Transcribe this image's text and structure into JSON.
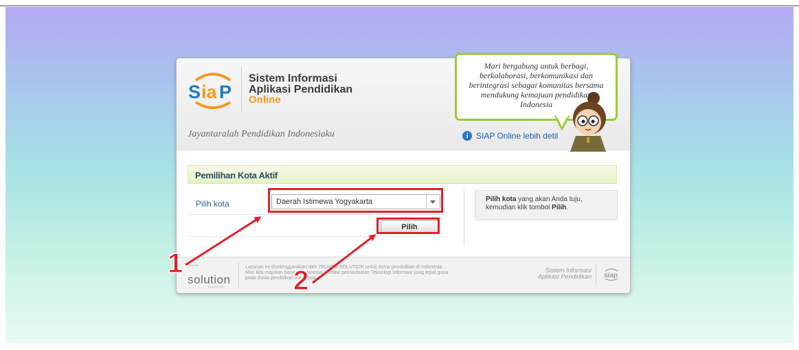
{
  "brand": {
    "logo_text": "SiaP",
    "title_line1": "Sistem Informasi",
    "title_line2": "Aplikasi Pendidikan",
    "title_line3": "Online",
    "tagline": "Jayantaralah Pendidikan Indonesiaku",
    "accent_color": "#f39a1e",
    "primary_color": "#1d7bc4"
  },
  "speech": {
    "text": "Mari bergabung untuk berbagi, berkolaborasi, berkomunikasi dan berintegrasi sebagai komunitas bersama mendukung kemajuan pendidikan Indonesia"
  },
  "detail_link": {
    "label": "SIAP Online lebih detil"
  },
  "form": {
    "section_title": "Pemilihan Kota Aktif",
    "city_label": "Pilih kota",
    "city_selected": "Daerah Istimewa Yogyakarta",
    "submit_label": "Pilih"
  },
  "help": {
    "bold_1": "Pilih kota",
    "text_1": " yang akan Anda tuju,",
    "text_2": "kemudian klik tombol ",
    "bold_2": "Pilih",
    "text_3": "."
  },
  "footer": {
    "partner_small": "TELKOM",
    "partner_name": "solution",
    "partner_tagline": "Education Partner",
    "text_line1": "Layanan ini diselenggarakan oleh TELKOM SOLUTION untuk dunia pendidikan di Indonesia.",
    "text_line2": "Mari kita majukan bangsa Indonesia, melalui pemanfaatan Teknologi Informasi yang tepat guna",
    "text_line3": "pada dunia pendidikan indonesia.",
    "right_line1": "Sistem Informasi",
    "right_line2": "Aplikasi Pendidikan",
    "right_logo": "siap"
  },
  "annotations": {
    "step1": "1",
    "step2": "2",
    "highlight_color": "#e0202a"
  }
}
